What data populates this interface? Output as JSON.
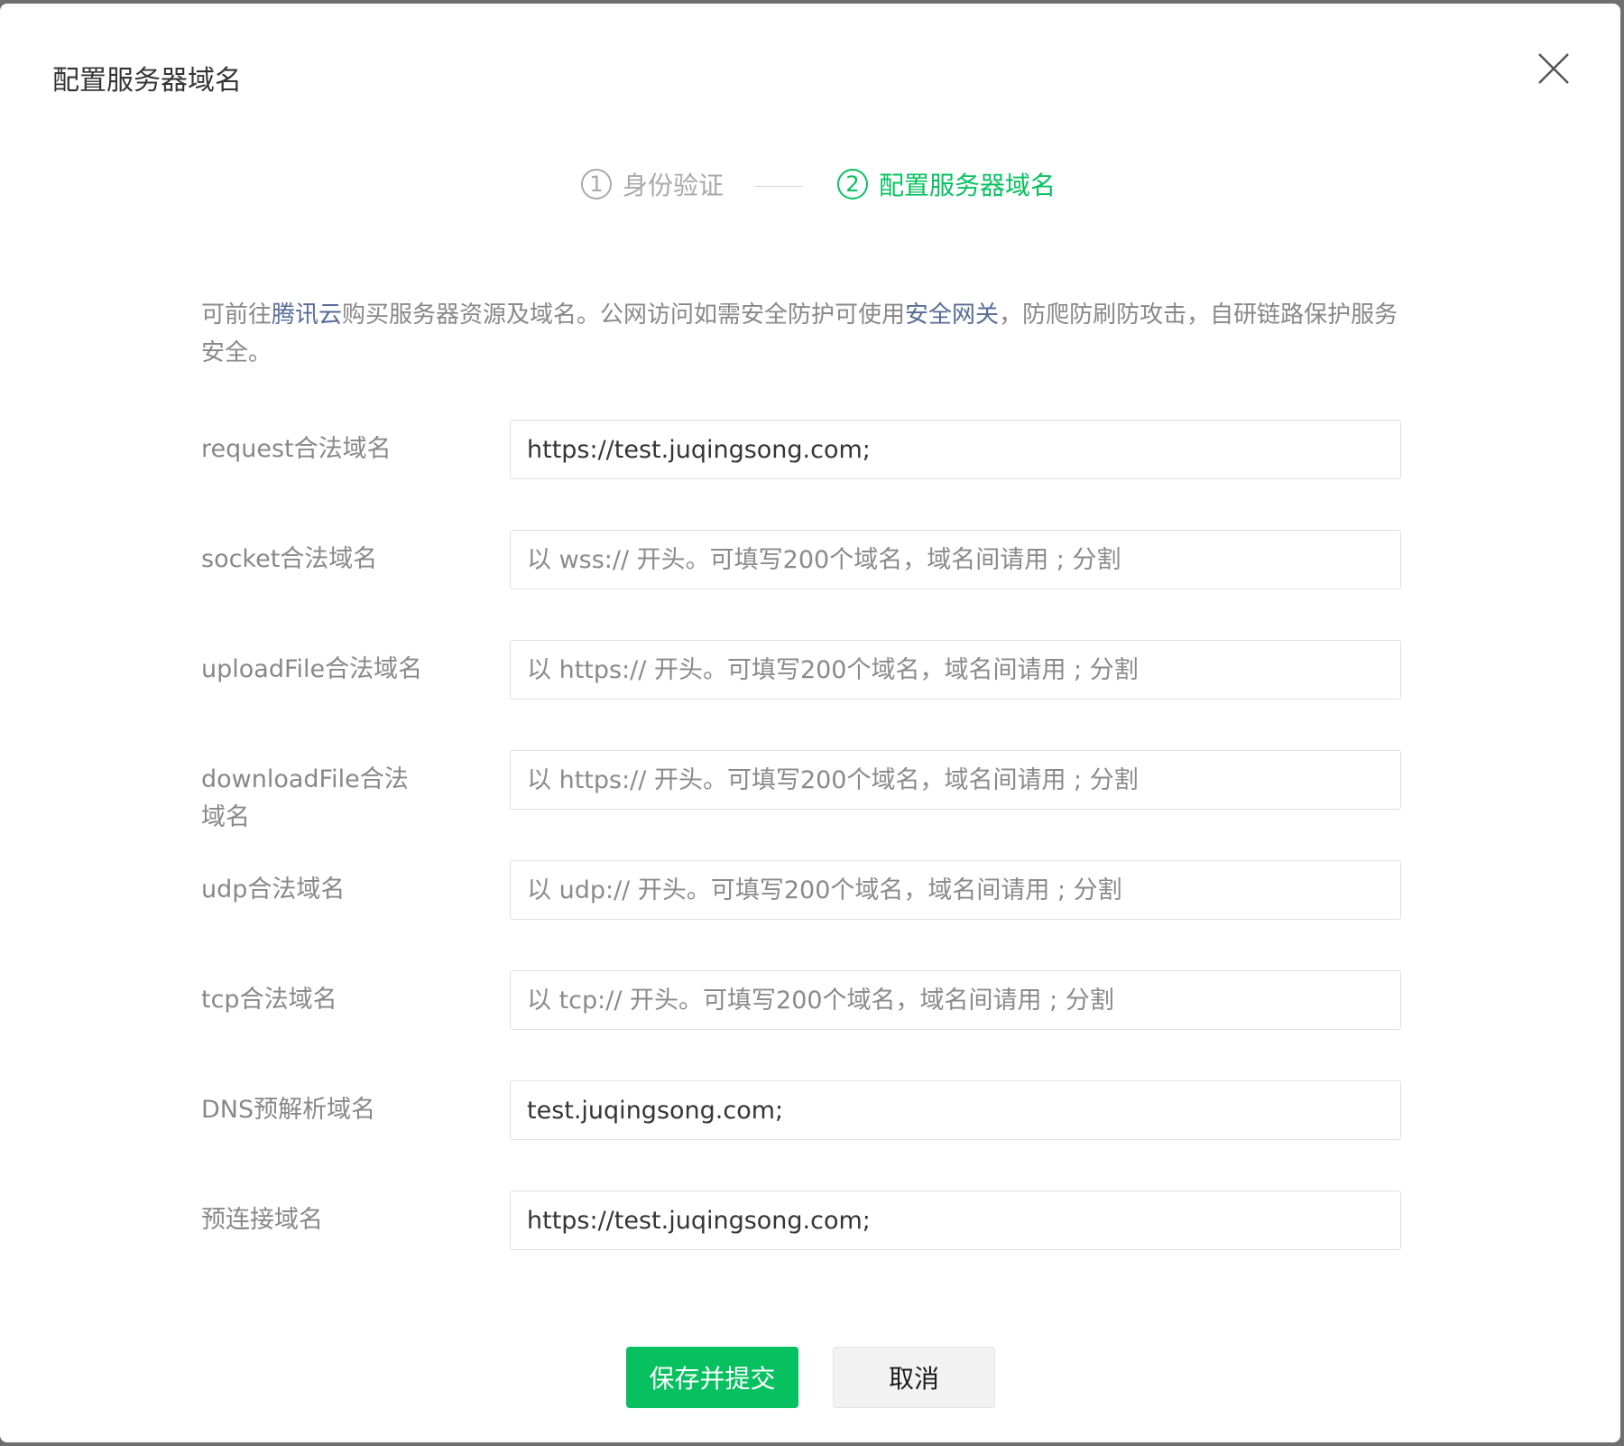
{
  "dialog": {
    "title": "配置服务器域名",
    "close_icon": "close-icon"
  },
  "steps": [
    {
      "number": "1",
      "label": "身份验证",
      "state": "done"
    },
    {
      "number": "2",
      "label": "配置服务器域名",
      "state": "active"
    }
  ],
  "description": {
    "part1": "可前往",
    "link1": "腾讯云",
    "part2": "购买服务器资源及域名。公网访问如需安全防护可使用",
    "link2": "安全网关",
    "part3": "，防爬防刷防攻击，自研链路保护服务安全。"
  },
  "fields": [
    {
      "label": "request合法域名",
      "value": "https://test.juqingsong.com;",
      "placeholder": ""
    },
    {
      "label": "socket合法域名",
      "value": "",
      "placeholder": "以 wss:// 开头。可填写200个域名，域名间请用 ; 分割"
    },
    {
      "label": "uploadFile合法域名",
      "value": "",
      "placeholder": "以 https:// 开头。可填写200个域名，域名间请用 ; 分割"
    },
    {
      "label": "downloadFile合法域名",
      "value": "",
      "placeholder": "以 https:// 开头。可填写200个域名，域名间请用 ; 分割"
    },
    {
      "label": "udp合法域名",
      "value": "",
      "placeholder": "以 udp:// 开头。可填写200个域名，域名间请用 ; 分割"
    },
    {
      "label": "tcp合法域名",
      "value": "",
      "placeholder": "以 tcp:// 开头。可填写200个域名，域名间请用 ; 分割"
    },
    {
      "label": "DNS预解析域名",
      "value": "test.juqingsong.com;",
      "placeholder": ""
    },
    {
      "label": "预连接域名",
      "value": "https://test.juqingsong.com;",
      "placeholder": ""
    }
  ],
  "buttons": {
    "submit": "保存并提交",
    "cancel": "取消"
  },
  "colors": {
    "accent": "#07c160",
    "link": "#576b95",
    "muted": "#888888"
  }
}
